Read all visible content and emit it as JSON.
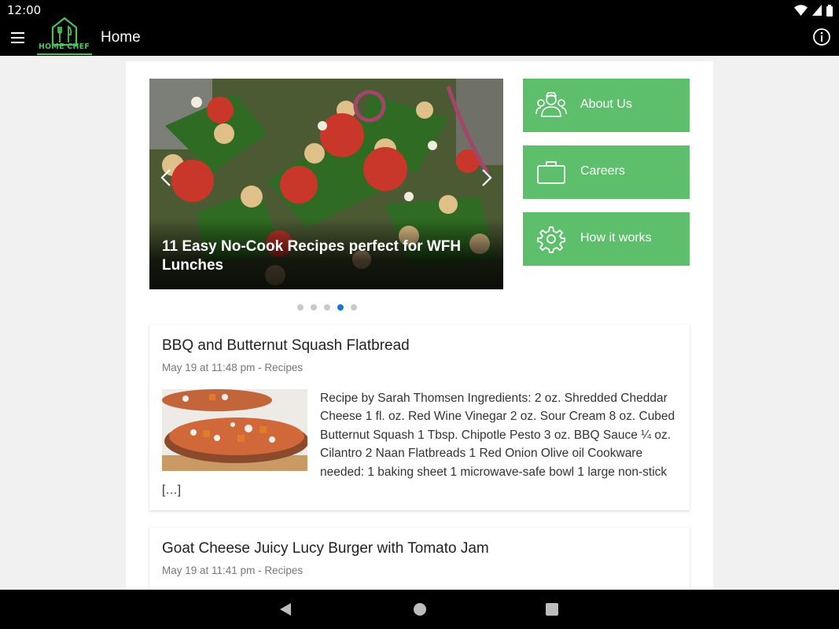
{
  "status_bar": {
    "time": "12:00"
  },
  "app_bar": {
    "title": "Home",
    "logo_text": "HOME CHEF"
  },
  "carousel": {
    "caption": "11 Easy No-Cook Recipes perfect for WFH Lunches",
    "slide_count": 5,
    "active_slide": 4
  },
  "side_buttons": [
    {
      "label": "About Us",
      "icon": "people-icon"
    },
    {
      "label": "Careers",
      "icon": "briefcase-icon"
    },
    {
      "label": "How it works",
      "icon": "gear-icon"
    }
  ],
  "posts": [
    {
      "title": "BBQ and Butternut Squash Flatbread",
      "meta": "May 19 at 11:48 pm - Recipes",
      "excerpt": "Recipe by Sarah Thomsen Ingredients: 2 oz. Shredded Cheddar Cheese 1 fl. oz. Red Wine Vinegar 2 oz. Sour Cream 8 oz. Cubed Butternut Squash 1 Tbsp. Chipotle Pesto 3 oz. BBQ Sauce ¼ oz. Cilantro 2 Naan Flatbreads 1 Red Onion Olive oil Cookware needed: 1 baking sheet 1 microwave-safe bowl 1 large non-stick […]"
    },
    {
      "title": "Goat Cheese Juicy Lucy Burger with Tomato Jam",
      "meta": "May 19 at 11:41 pm - Recipes"
    }
  ],
  "colors": {
    "accent_green": "#5dbf6b",
    "logo_green": "#4fbf5b",
    "dot_active": "#1976d2",
    "dot_inactive": "#c9c9c9"
  }
}
